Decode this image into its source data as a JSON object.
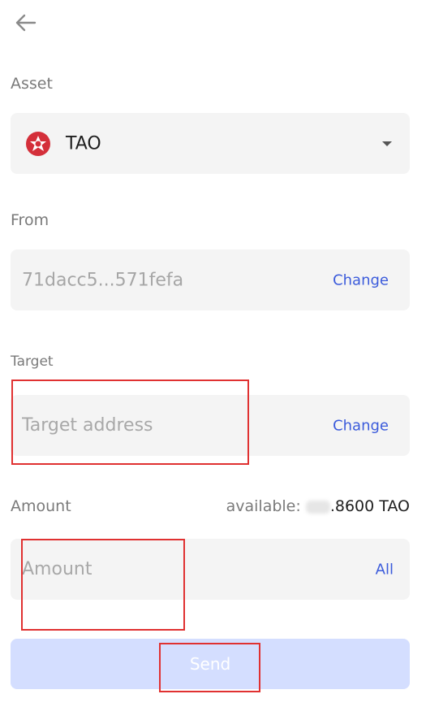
{
  "nav": {
    "back_icon": "arrow-left-icon"
  },
  "asset": {
    "label": "Asset",
    "selected": "TAO",
    "logo_icon": "tao-logo-icon",
    "logo_color": "#d42f3a",
    "dropdown_icon": "caret-down-icon"
  },
  "from": {
    "label": "From",
    "address": "71dacc5...571fefa",
    "change_label": "Change"
  },
  "target": {
    "label": "Target",
    "placeholder": "Target address",
    "change_label": "Change"
  },
  "amount": {
    "label": "Amount",
    "available_prefix": "available: ",
    "available_value": ".8600 TAO",
    "placeholder": "Amount",
    "all_label": "All"
  },
  "send": {
    "label": "Send",
    "bg_color": "#d4deff"
  },
  "colors": {
    "accent": "#3b5bdb",
    "annotation": "#e03131",
    "field_bg": "#f4f4f4"
  }
}
